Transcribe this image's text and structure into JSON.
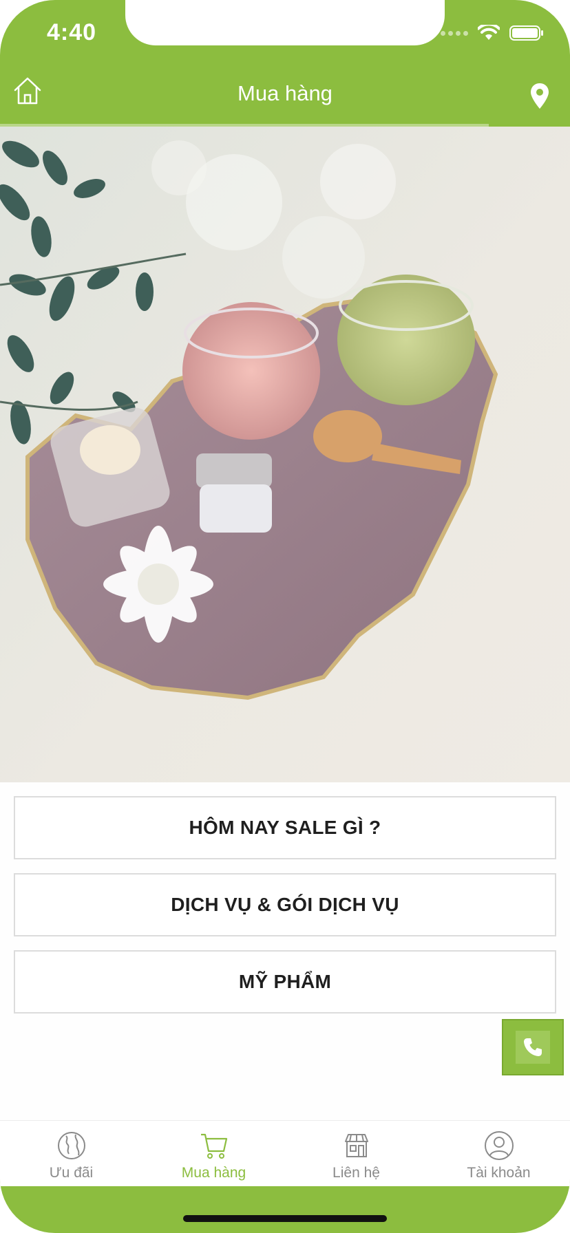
{
  "status_bar": {
    "time": "4:40"
  },
  "header": {
    "title": "Mua hàng"
  },
  "hero_image": {
    "description_icon": "spa-products-photo"
  },
  "menu": [
    {
      "label": "HÔM NAY SALE GÌ ?"
    },
    {
      "label": "DỊCH VỤ & GÓI DỊCH VỤ"
    },
    {
      "label": "MỸ PHẨM"
    }
  ],
  "tabs": [
    {
      "label": "Ưu đãi",
      "icon": "globe-icon",
      "active": false
    },
    {
      "label": "Mua hàng",
      "icon": "cart-icon",
      "active": true
    },
    {
      "label": "Liên hệ",
      "icon": "store-icon",
      "active": false
    },
    {
      "label": "Tài khoản",
      "icon": "user-icon",
      "active": false
    }
  ],
  "colors": {
    "brand_green": "#8cbd3f",
    "tab_inactive": "#8a8a8a",
    "button_border": "#dcdcdc"
  }
}
